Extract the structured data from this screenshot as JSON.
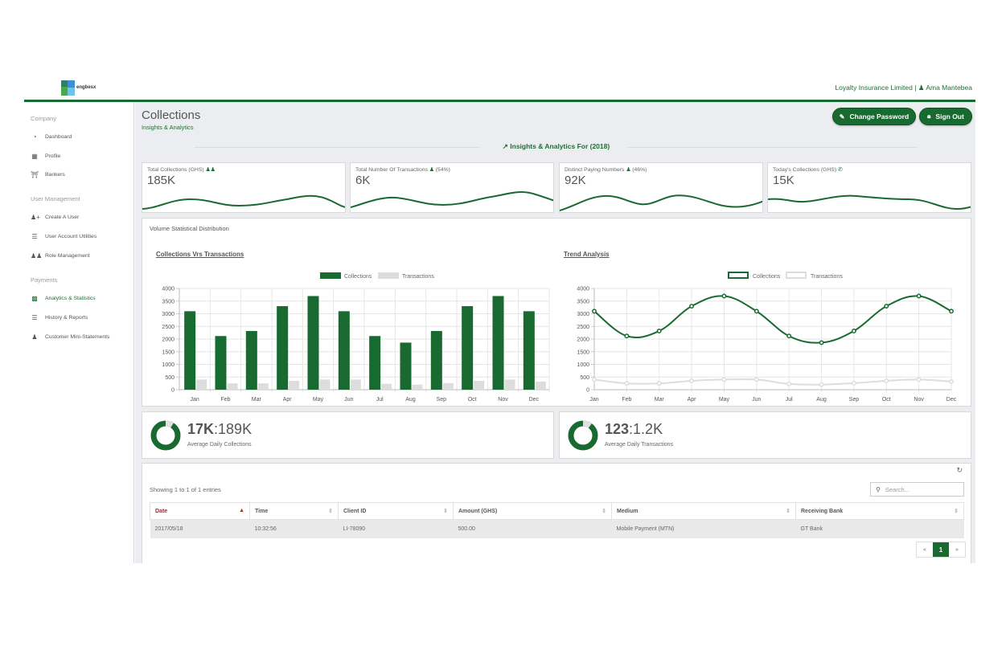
{
  "brand": {
    "logo_text": "engbesx"
  },
  "header": {
    "company": "Loyalty Insurance Limited",
    "separator": "|",
    "user": "Ama Mantebea"
  },
  "sidebar": {
    "sections": [
      {
        "title": "Company",
        "items": [
          {
            "label": "Dashboard",
            "icon": "dashboard-icon"
          },
          {
            "label": "Profile",
            "icon": "building-icon"
          },
          {
            "label": "Bankers",
            "icon": "bank-icon"
          }
        ]
      },
      {
        "title": "User Management",
        "items": [
          {
            "label": "Create A User",
            "icon": "add-user-icon"
          },
          {
            "label": "User Account Utilities",
            "icon": "list-icon"
          },
          {
            "label": "Role Management",
            "icon": "users-icon"
          }
        ]
      },
      {
        "title": "Payments",
        "items": [
          {
            "label": "Analytics & Statistics",
            "icon": "bar-chart-icon",
            "active": true
          },
          {
            "label": "History & Reports",
            "icon": "list-icon"
          },
          {
            "label": "Customer Mini-Statements",
            "icon": "person-icon"
          }
        ]
      }
    ]
  },
  "page": {
    "title": "Collections",
    "subtitle": "Insights & Analytics",
    "buttons": {
      "change_password": "Change Password",
      "sign_out": "Sign Out"
    },
    "section_title": "Insights & Analytics For (2018)"
  },
  "stats": [
    {
      "label": "Total Collections (GHS)",
      "suffix": "",
      "value": "185K",
      "icon": "users-icon"
    },
    {
      "label": "Total Number Of Transactions",
      "suffix": "(54%)",
      "value": "6K",
      "icon": "person-icon"
    },
    {
      "label": "Distinct Paying Numbers",
      "suffix": "(46%)",
      "value": "92K",
      "icon": "person-icon"
    },
    {
      "label": "Today's Collections (GHS)",
      "suffix": "",
      "value": "15K",
      "icon": "phone-icon"
    }
  ],
  "charts_panel": {
    "title": "Volume Statistical Distribution"
  },
  "chart_data": [
    {
      "type": "bar",
      "title": "Collections Vrs Transactions",
      "categories": [
        "Jan",
        "Feb",
        "Mar",
        "Apr",
        "May",
        "Jun",
        "Jul",
        "Aug",
        "Sep",
        "Oct",
        "Nov",
        "Dec"
      ],
      "series": [
        {
          "name": "Collections",
          "values": [
            3100,
            2120,
            2320,
            3300,
            3700,
            3100,
            2120,
            1860,
            2320,
            3300,
            3700,
            3100
          ]
        },
        {
          "name": "Transactions",
          "values": [
            400,
            250,
            250,
            350,
            400,
            400,
            230,
            200,
            260,
            350,
            400,
            320
          ]
        }
      ],
      "yticks": [
        0,
        500,
        1000,
        1500,
        2000,
        2500,
        3000,
        3500,
        4000
      ],
      "ylim": [
        0,
        4000
      ],
      "legend": "top",
      "grid": true,
      "colors": [
        "#186a30",
        "#dddddd"
      ]
    },
    {
      "type": "line",
      "title": "Trend Analysis",
      "categories": [
        "Jan",
        "Feb",
        "Mar",
        "Apr",
        "May",
        "Jun",
        "Jul",
        "Aug",
        "Sep",
        "Oct",
        "Nov",
        "Dec"
      ],
      "series": [
        {
          "name": "Collections",
          "values": [
            3100,
            2120,
            2320,
            3300,
            3700,
            3100,
            2120,
            1860,
            2320,
            3300,
            3700,
            3100
          ]
        },
        {
          "name": "Transactions",
          "values": [
            400,
            250,
            250,
            350,
            400,
            400,
            230,
            200,
            260,
            350,
            400,
            320
          ]
        }
      ],
      "yticks": [
        0,
        500,
        1000,
        1500,
        2000,
        2500,
        3000,
        3500,
        4000
      ],
      "ylim": [
        0,
        4000
      ],
      "legend": "top",
      "grid": true,
      "colors": [
        "#186a30",
        "#dddddd"
      ]
    }
  ],
  "averages": [
    {
      "value": "17K",
      "total": ":189K",
      "label": "Average Daily Collections",
      "fraction": 0.09
    },
    {
      "value": "123",
      "total": ":1.2K",
      "label": "Average Daily Transactions",
      "fraction": 0.1
    }
  ],
  "table": {
    "showing": "Showing 1 to 1 of 1 entries",
    "search_placeholder": "Search...",
    "columns": [
      "Date",
      "Time",
      "Client ID",
      "Amount (GHS)",
      "Medium",
      "Receiving Bank"
    ],
    "rows": [
      [
        "2017/05/18",
        "10:32:56",
        "LI-78090",
        "500.00",
        "Mobile Payment (MTN)",
        "GT Bank"
      ]
    ],
    "pagination": {
      "prev": "«",
      "current": "1",
      "next": "»"
    }
  },
  "colors": {
    "accent": "#186a30",
    "sort_active": "#a52a2a",
    "background": "#ebedf0"
  }
}
